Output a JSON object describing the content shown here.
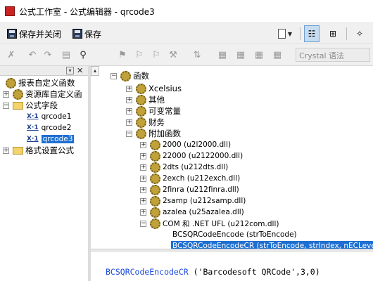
{
  "window": {
    "title": "公式工作室 - 公式编辑器 - qrcode3"
  },
  "toolbar1": {
    "save_close_label": "保存并关闭",
    "save_label": "保存"
  },
  "toolbar2": {
    "syntax_select_value": "Crystal 语法"
  },
  "left_tree": {
    "items": [
      {
        "label": "报表自定义函数",
        "expanded": false
      },
      {
        "label": "资源库自定义函",
        "expanded": false
      },
      {
        "label": "公式字段",
        "expanded": true
      },
      {
        "label": "qrcode1"
      },
      {
        "label": "qrcode2"
      },
      {
        "label": "qrcode3",
        "selected": true
      },
      {
        "label": "格式设置公式",
        "expanded": false
      }
    ]
  },
  "func_tree": {
    "items": [
      {
        "label": "函数"
      },
      {
        "label": "Xcelsius"
      },
      {
        "label": "其他"
      },
      {
        "label": "可变常量"
      },
      {
        "label": "财务"
      },
      {
        "label": "附加函数"
      },
      {
        "label": "2000 (u2l2000.dll)"
      },
      {
        "label": "22000 (u2122000.dll)"
      },
      {
        "label": "2dts (u212dts.dll)"
      },
      {
        "label": "2exch (u212exch.dll)"
      },
      {
        "label": "2finra (u212finra.dll)"
      },
      {
        "label": "2samp (u212samp.dll)"
      },
      {
        "label": "azalea (u25azalea.dll)"
      },
      {
        "label": "COM 和 .NET UFL (u212com.dll)"
      },
      {
        "label": "BCSQRCodeEncode (strToEncode)"
      },
      {
        "label": "BCSQRCodeEncodeCR (strToEncode, strIndex, nECLevel)"
      }
    ]
  },
  "editor": {
    "function_name": "BCSQRCodeEncodeCR",
    "arguments": " ('Barcodesoft QRCode',3,0)"
  }
}
